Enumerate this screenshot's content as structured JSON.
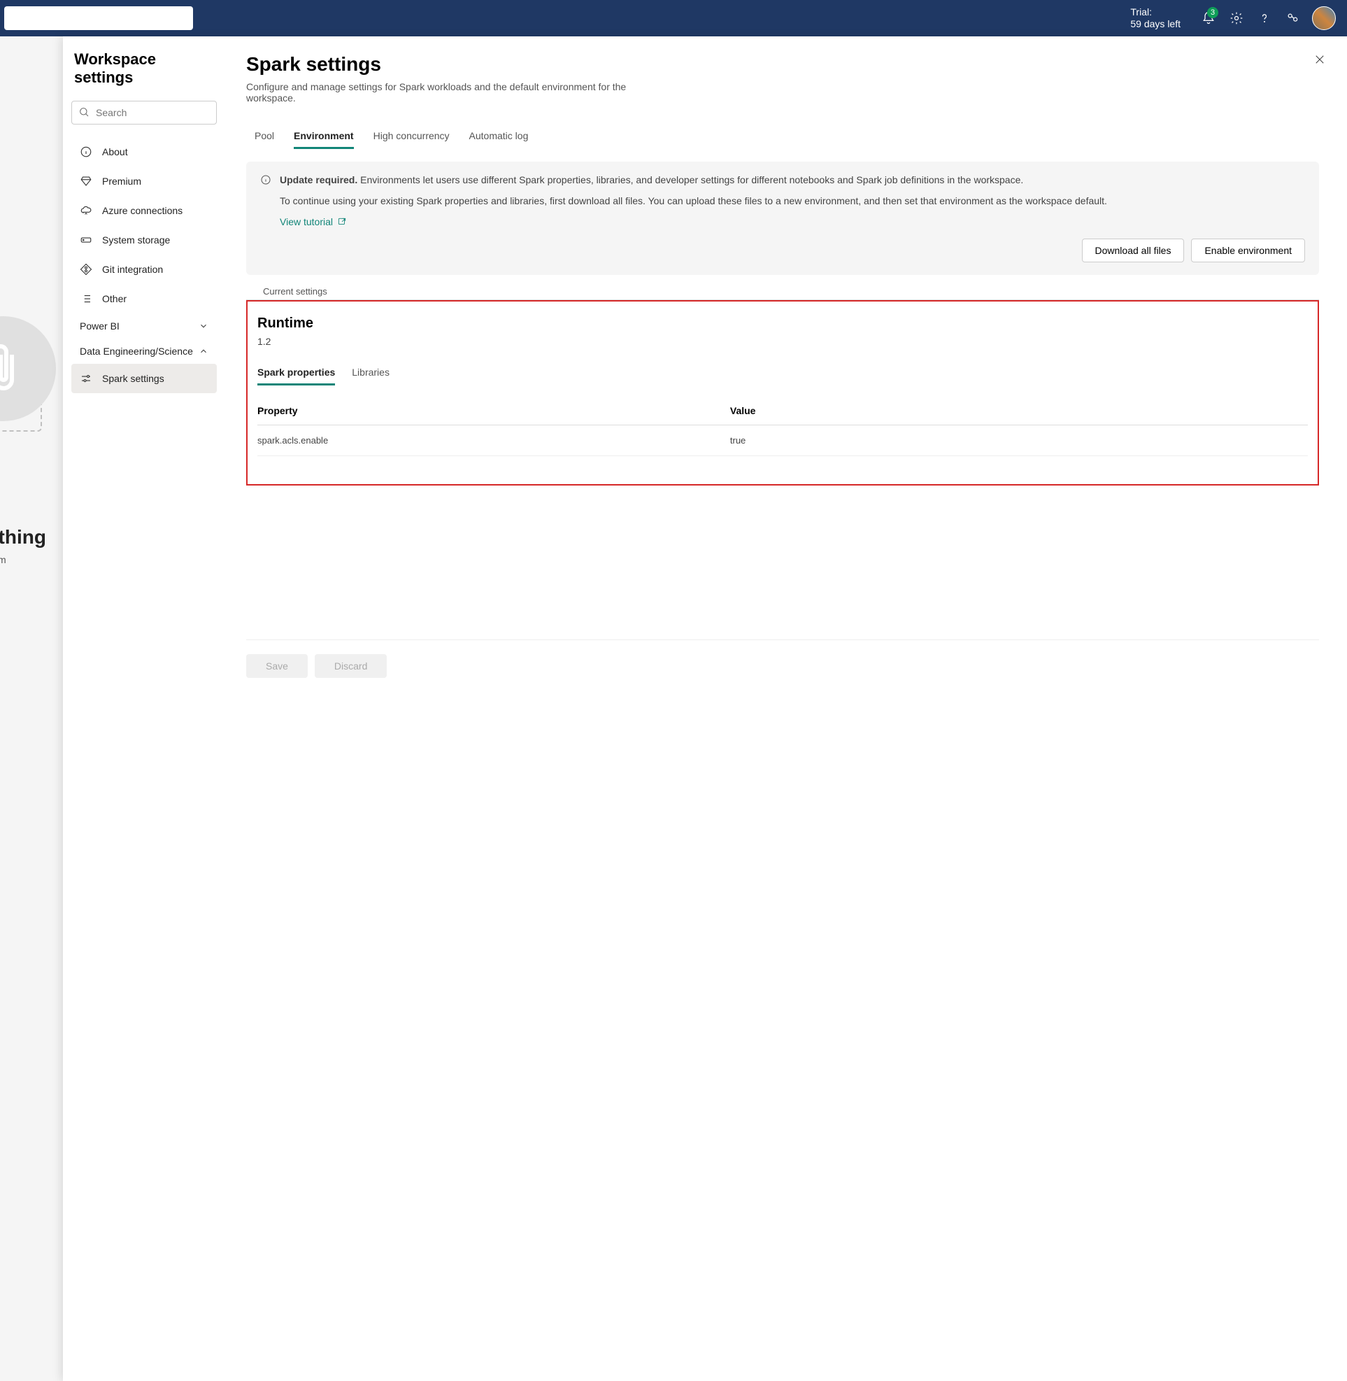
{
  "topbar": {
    "trial_line1": "Trial:",
    "trial_line2": "59 days left",
    "badge": "3"
  },
  "search": {
    "placeholder": "Search"
  },
  "panel_title": "Workspace settings",
  "nav": {
    "about": "About",
    "premium": "Premium",
    "azure": "Azure connections",
    "storage": "System storage",
    "git": "Git integration",
    "other": "Other",
    "group_powerbi": "Power BI",
    "group_de": "Data Engineering/Science",
    "spark": "Spark settings"
  },
  "main": {
    "title": "Spark settings",
    "desc": "Configure and manage settings for Spark workloads and the default environment for the workspace."
  },
  "tabs": {
    "pool": "Pool",
    "env": "Environment",
    "high": "High concurrency",
    "auto": "Automatic log"
  },
  "infobox": {
    "strong": "Update required.",
    "p1": " Environments let users use different Spark properties, libraries, and developer settings for different notebooks and Spark job definitions in the workspace.",
    "p2": "To continue using your existing Spark properties and libraries, first download all files. You can upload these files to a new environment, and then set that environment as the workspace default.",
    "link": "View tutorial",
    "download": "Download all files",
    "enable": "Enable environment"
  },
  "section_label": "Current settings",
  "runtime": {
    "title": "Runtime",
    "version": "1.2"
  },
  "subtabs": {
    "props": "Spark properties",
    "libs": "Libraries"
  },
  "table": {
    "head_prop": "Property",
    "head_val": "Value",
    "rows": [
      {
        "prop": "spark.acls.enable",
        "val": "true"
      }
    ]
  },
  "footer": {
    "save": "Save",
    "discard": "Discard"
  },
  "backdrop": {
    "line1": "s nothing",
    "line2": "or upload som"
  }
}
